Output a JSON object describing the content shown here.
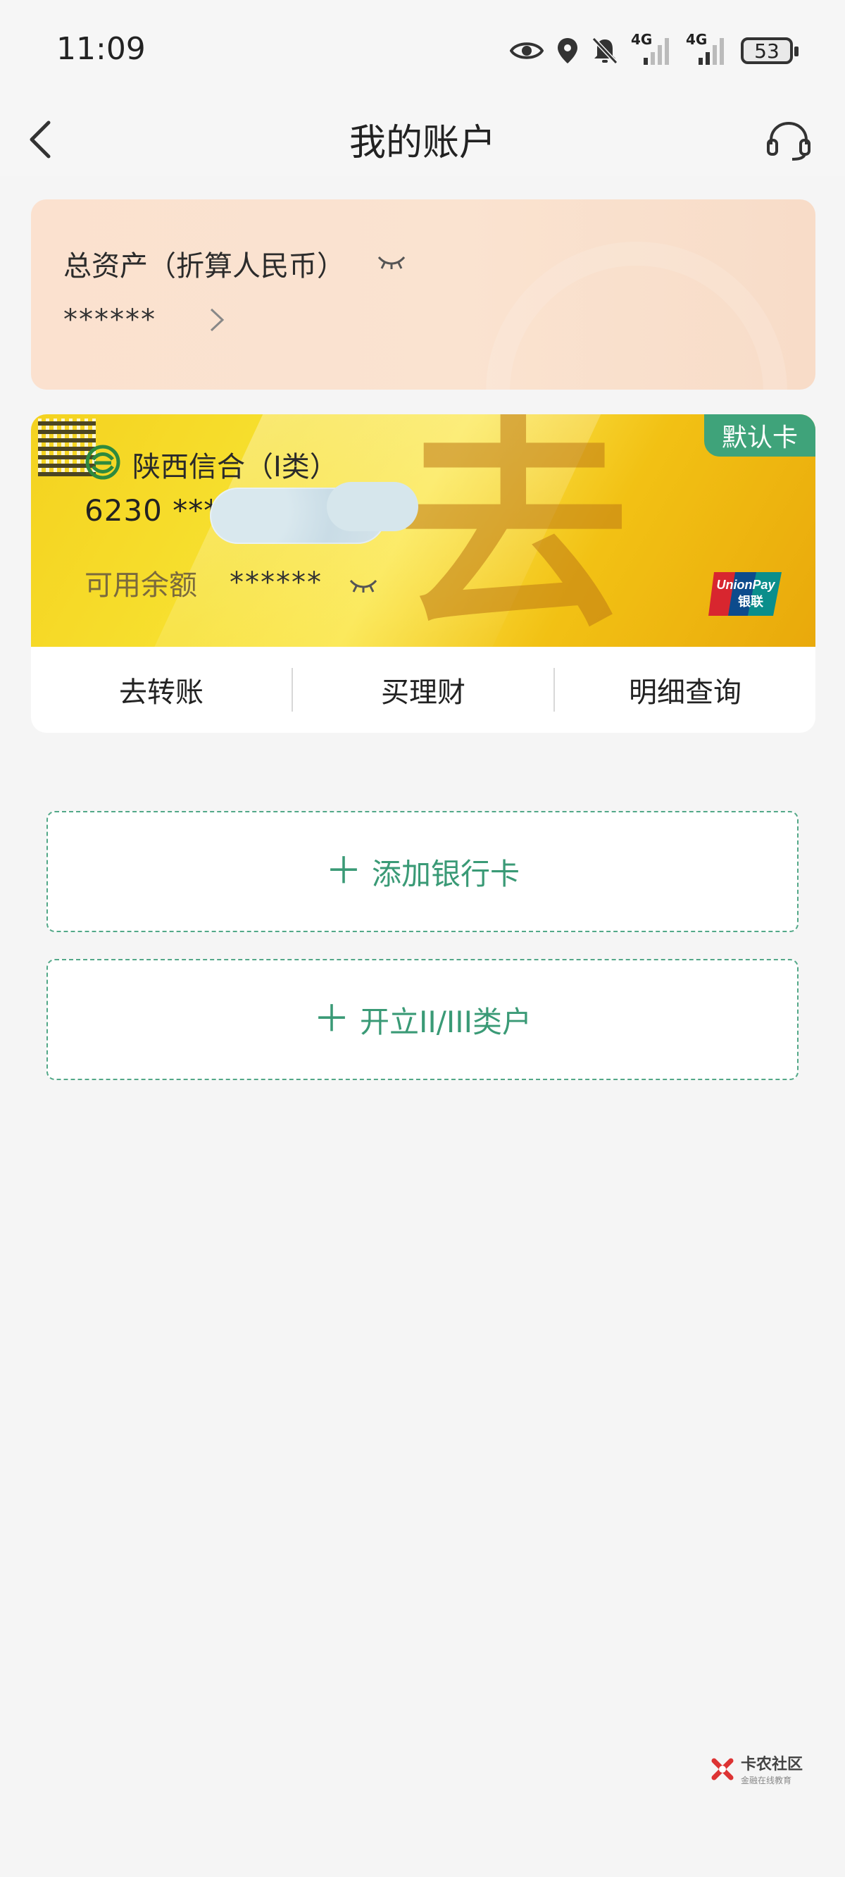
{
  "status_bar": {
    "time": "11:09",
    "network_1": "4G",
    "network_2": "4G",
    "battery": "53"
  },
  "header": {
    "title": "我的账户"
  },
  "assets": {
    "label": "总资产（折算人民币）",
    "value": "******"
  },
  "card": {
    "default_badge": "默认卡",
    "bank_name": "陕西信合（I类）",
    "card_number_prefix": "6230 ***",
    "balance_label": "可用余额",
    "balance_value": "******",
    "network_logo_text_1": "UnionPay",
    "network_logo_text_2": "银联",
    "calligraphy_char": "去"
  },
  "card_actions": [
    {
      "label": "去转账"
    },
    {
      "label": "买理财"
    },
    {
      "label": "明细查询"
    }
  ],
  "buttons": {
    "add_card": "添加银行卡",
    "open_account": "开立II/III类户"
  },
  "watermark": {
    "line1": "卡农社区",
    "line2": "金融在线教育"
  },
  "colors": {
    "accent_green": "#3a9a76",
    "assets_card_bg": "#fae3d0",
    "card_yellow": "#f7e02f"
  }
}
